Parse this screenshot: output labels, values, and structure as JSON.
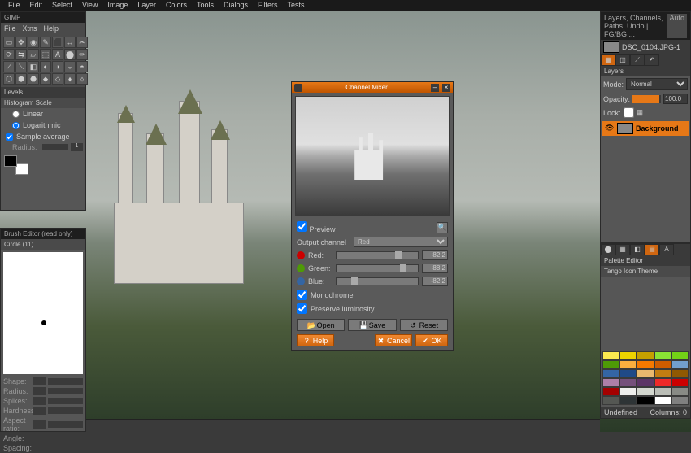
{
  "app": {
    "title": "GIMP"
  },
  "main_menu": [
    "File",
    "Edit",
    "Select",
    "View",
    "Image",
    "Layer",
    "Colors",
    "Tools",
    "Dialogs",
    "Filters",
    "Tests"
  ],
  "toolbox": {
    "menu": [
      "File",
      "Xtns",
      "Help"
    ],
    "tools": [
      "▭",
      "✥",
      "◉",
      "✎",
      "⬛",
      "↔",
      "✂",
      "⟳",
      "⇆",
      "▱",
      "⬚",
      "A",
      "⬤",
      "✏",
      "⟋",
      "⟍",
      "◧",
      "◐",
      "◑",
      "◒",
      "◓",
      "⬡",
      "⬢",
      "⬣",
      "⬥",
      "⬦",
      "⬧",
      "⬨"
    ],
    "levels_title": "Levels",
    "histogram_title": "Histogram Scale",
    "hist_linear": "Linear",
    "hist_log": "Logarithmic",
    "sample_avg": "Sample average",
    "radius_label": "Radius:",
    "radius_value": "1"
  },
  "brush": {
    "title": "Brush Editor (read only)",
    "name": "Circle (11)",
    "params": [
      {
        "label": "Shape:",
        "val": ""
      },
      {
        "label": "Radius:",
        "val": ""
      },
      {
        "label": "Spikes:",
        "val": ""
      },
      {
        "label": "Hardness:",
        "val": ""
      },
      {
        "label": "Aspect ratio:",
        "val": ""
      },
      {
        "label": "Angle:",
        "val": ""
      },
      {
        "label": "Spacing:",
        "val": ""
      }
    ]
  },
  "layers": {
    "title": "Layers, Channels, Paths, Undo | FG/BG ...",
    "auto": "Auto",
    "image_name": "DSC_0104.JPG-1",
    "section": "Layers",
    "mode_label": "Mode:",
    "mode_value": "Normal",
    "opacity_label": "Opacity:",
    "opacity_value": "100.0",
    "lock_label": "Lock:",
    "layer_name": "Background"
  },
  "palette": {
    "title": "Palette Editor",
    "name": "Tango Icon Theme",
    "colors": [
      "#fce94f",
      "#edd400",
      "#c4a000",
      "#8ae234",
      "#73d216",
      "#4e9a06",
      "#fcaf3e",
      "#f57900",
      "#ce5c00",
      "#729fcf",
      "#3465a4",
      "#204a87",
      "#e9b96e",
      "#c17d11",
      "#8f5902",
      "#ad7fa8",
      "#75507b",
      "#5c3566",
      "#ef2929",
      "#cc0000",
      "#a40000",
      "#eeeeec",
      "#d3d7cf",
      "#babdb6",
      "#888a85",
      "#555753",
      "#2e3436",
      "#000000",
      "#ffffff",
      "#808080"
    ],
    "undefined": "Undefined",
    "columns_label": "Columns:",
    "columns_value": "0"
  },
  "dialog": {
    "title": "Channel Mixer",
    "preview_label": "Preview",
    "output_label": "Output channel",
    "output_value": "Red",
    "channels": [
      {
        "name": "Red:",
        "color": "#cc0000",
        "value": "82.2",
        "pos": 72
      },
      {
        "name": "Green:",
        "color": "#4e9a06",
        "value": "88.2",
        "pos": 78
      },
      {
        "name": "Blue:",
        "color": "#3465a4",
        "value": "-82.2",
        "pos": 18
      }
    ],
    "mono": "Monochrome",
    "preserve": "Preserve luminosity",
    "open": "Open",
    "save": "Save",
    "reset": "Reset",
    "help": "Help",
    "cancel": "Cancel",
    "ok": "OK"
  }
}
